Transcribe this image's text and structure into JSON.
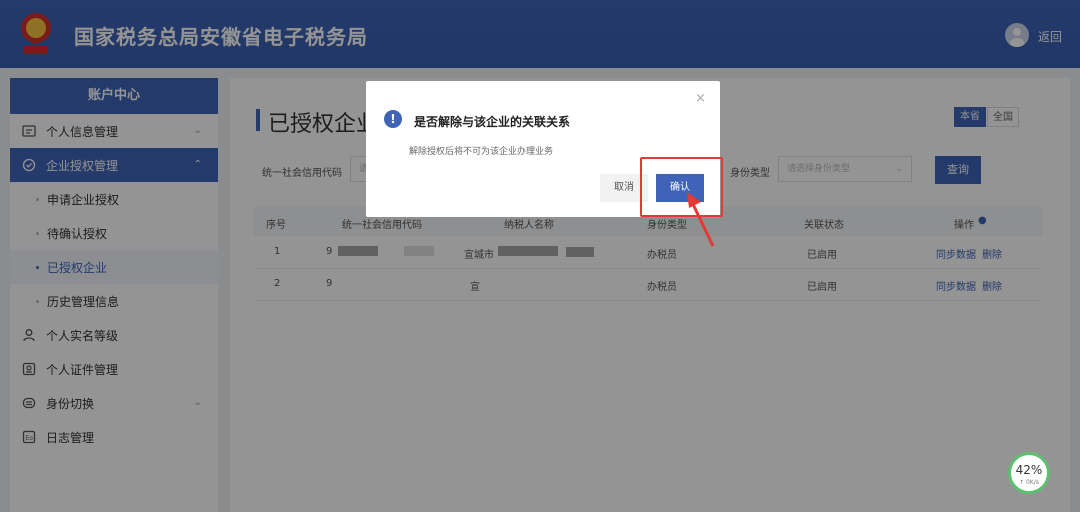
{
  "header": {
    "title": "国家税务总局安徽省电子税务局",
    "back_label": "返回",
    "brand_color": "#3f64b7"
  },
  "sidebar": {
    "title": "账户中心",
    "items": [
      {
        "label": "个人信息管理",
        "icon": "user-card-icon"
      },
      {
        "label": "企业授权管理",
        "icon": "check-circle-icon"
      },
      {
        "label": "申请企业授权"
      },
      {
        "label": "待确认授权"
      },
      {
        "label": "已授权企业"
      },
      {
        "label": "历史管理信息"
      },
      {
        "label": "个人实名等级",
        "icon": "person-icon"
      },
      {
        "label": "个人证件管理",
        "icon": "id-card-icon"
      },
      {
        "label": "身份切换",
        "icon": "switch-icon"
      },
      {
        "label": "日志管理",
        "icon": "log-icon"
      }
    ]
  },
  "main": {
    "title": "已授权企业",
    "scope_tabs": [
      "本省",
      "全国"
    ],
    "filters": {
      "credit_code_label": "统一社会信用代码",
      "credit_code_placeholder": "请",
      "identity_label": "身份类型",
      "identity_placeholder": "请选择身份类型",
      "query_label": "查询"
    },
    "table": {
      "headers": [
        "序号",
        "统一社会信用代码",
        "纳税人名称",
        "身份类型",
        "关联状态",
        "操作"
      ],
      "rows": [
        {
          "no": "1",
          "code": "9",
          "name": "宣城市",
          "identity": "办税员",
          "status": "已启用",
          "sync": "同步数据",
          "delete": "删除"
        },
        {
          "no": "2",
          "code": "9",
          "name": "宣",
          "identity": "办税员",
          "status": "已启用",
          "sync": "同步数据",
          "delete": "删除"
        }
      ]
    }
  },
  "dialog": {
    "title": "是否解除与该企业的关联关系",
    "message": "解除授权后将不可为该企业办理业务",
    "cancel_label": "取消",
    "confirm_label": "确认"
  },
  "speed_widget": {
    "percent": "42%",
    "rate": "↑ 0K/s"
  }
}
